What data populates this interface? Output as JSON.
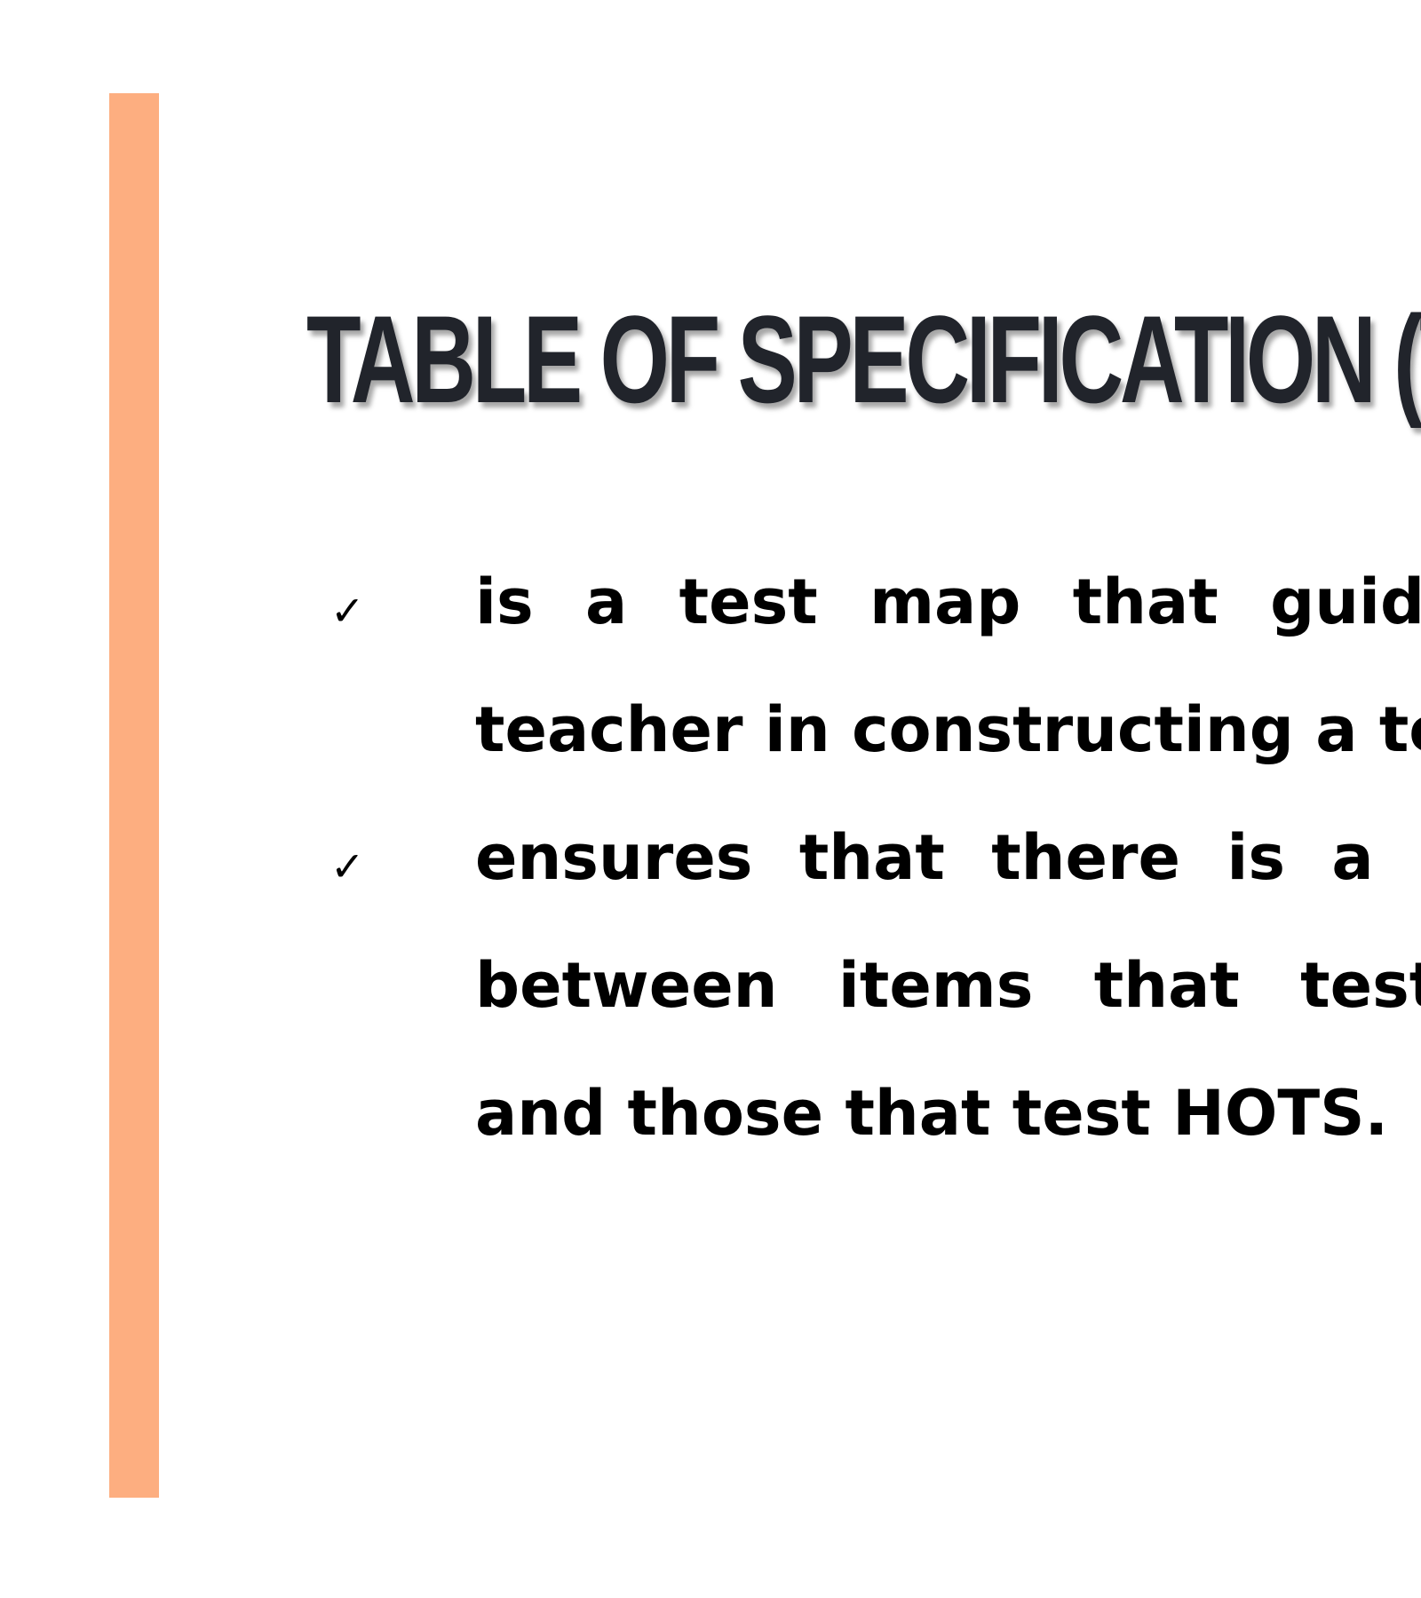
{
  "slide": {
    "accent_color": "#FDAE80",
    "title": "TABLE OF SPECIFICATION (T",
    "bullet_icon": "checkmark-icon",
    "bullets": [
      {
        "check": "✓",
        "lines": [
          "is a test map that guides",
          "teacher in constructing a test."
        ]
      },
      {
        "check": "✓",
        "lines": [
          "ensures that there is a balar",
          "between items that test LC",
          "and those that test HOTS."
        ]
      }
    ]
  }
}
